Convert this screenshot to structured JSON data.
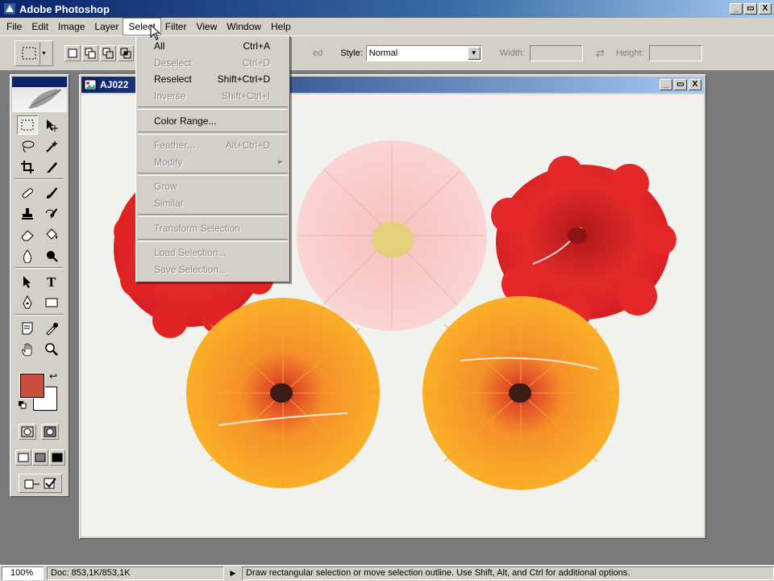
{
  "window": {
    "title": "Adobe Photoshop",
    "controls": [
      "_",
      "▭",
      "X"
    ]
  },
  "menubar": {
    "items": [
      "File",
      "Edit",
      "Image",
      "Layer",
      "Select",
      "Filter",
      "View",
      "Window",
      "Help"
    ],
    "active": "Select"
  },
  "options": {
    "feather_label": "ed",
    "style_label": "Style:",
    "style_value": "Normal",
    "width_label": "Width:",
    "height_label": "Height:"
  },
  "document": {
    "title": "AJ022"
  },
  "select_menu": {
    "items": [
      {
        "label": "All",
        "shortcut": "Ctrl+A",
        "enabled": true
      },
      {
        "label": "Deselect",
        "shortcut": "Ctrl+D",
        "enabled": false
      },
      {
        "label": "Reselect",
        "shortcut": "Shift+Ctrl+D",
        "enabled": true
      },
      {
        "label": "Inverse",
        "shortcut": "Shift+Ctrl+I",
        "enabled": false
      },
      {
        "label": "Color Range...",
        "shortcut": "",
        "enabled": true
      },
      {
        "label": "Feather...",
        "shortcut": "Alt+Ctrl+D",
        "enabled": false
      },
      {
        "label": "Modify",
        "shortcut": "",
        "enabled": false,
        "submenu": true
      },
      {
        "label": "Grow",
        "shortcut": "",
        "enabled": false
      },
      {
        "label": "Similar",
        "shortcut": "",
        "enabled": false
      },
      {
        "label": "Transform Selection",
        "shortcut": "",
        "enabled": false
      },
      {
        "label": "Load Selection...",
        "shortcut": "",
        "enabled": false
      },
      {
        "label": "Save Selection...",
        "shortcut": "",
        "enabled": false
      }
    ]
  },
  "colors": {
    "foreground": "#c95040",
    "background": "#ffffff",
    "titlebar": "#0a246a"
  },
  "status": {
    "zoom": "100%",
    "doc": "Doc: 853,1K/853,1K",
    "message": "Draw rectangular selection or move selection outline.  Use Shift, Alt, and Ctrl for additional options."
  }
}
